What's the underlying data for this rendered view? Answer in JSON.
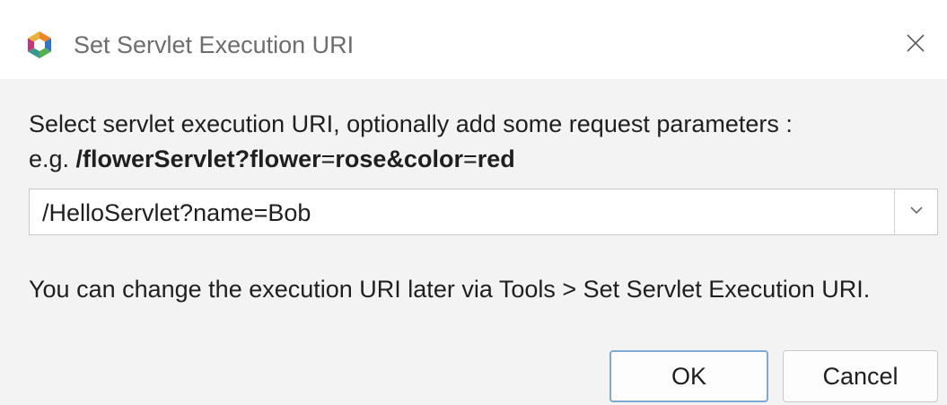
{
  "window": {
    "title": "Set Servlet Execution URI",
    "app_icon": "netbeans-cube-icon",
    "close_icon": "close-icon"
  },
  "instruction": {
    "line1": "Select servlet execution URI, optionally add some request parameters :",
    "example_prefix": "e.g. ",
    "example_path": "/flowerServlet?flower",
    "example_eq1": "=",
    "example_val1": "rose&color",
    "example_eq2": "=",
    "example_val2": "red"
  },
  "uri_combo": {
    "value": "/HelloServlet?name=Bob",
    "arrow_icon": "chevron-down-icon"
  },
  "hint": "You can change the execution URI later via Tools > Set Servlet Execution URI.",
  "buttons": {
    "ok": "OK",
    "cancel": "Cancel"
  },
  "colors": {
    "icon_orange": "#f0862a",
    "icon_blue": "#2f76c8",
    "icon_green": "#52b04f",
    "icon_magenta": "#c6347a",
    "ok_focus_border": "#7fa8d4"
  }
}
